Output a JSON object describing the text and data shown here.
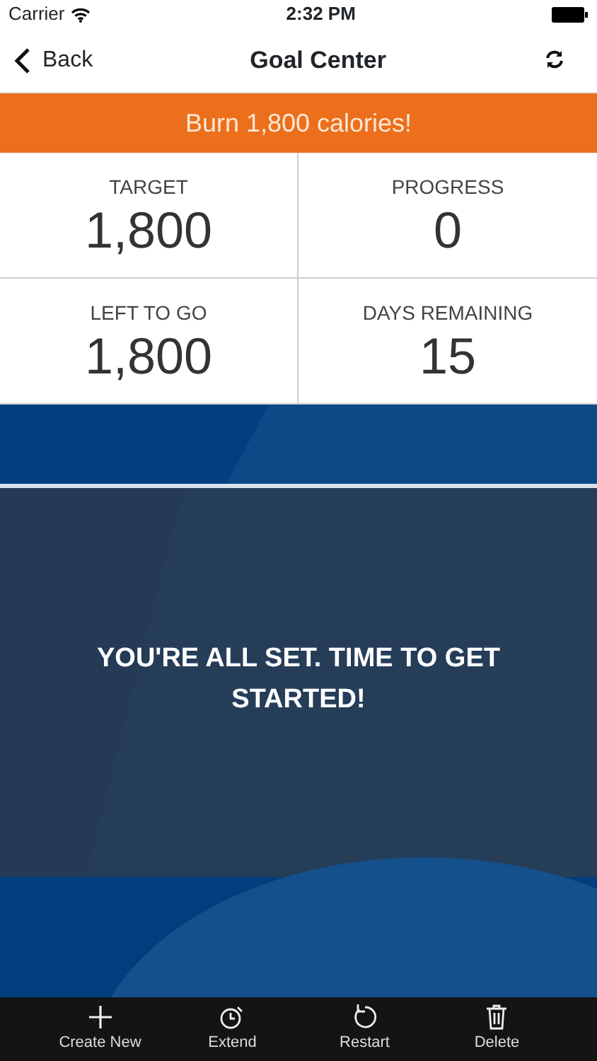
{
  "status_bar": {
    "carrier": "Carrier",
    "time": "2:32 PM"
  },
  "nav": {
    "back": "Back",
    "title": "Goal Center"
  },
  "banner": "Burn 1,800 calories!",
  "stats": [
    {
      "label": "TARGET",
      "value": "1,800"
    },
    {
      "label": "PROGRESS",
      "value": "0"
    },
    {
      "label": "LEFT TO GO",
      "value": "1,800"
    },
    {
      "label": "DAYS REMAINING",
      "value": "15"
    }
  ],
  "message": "YOU'RE ALL SET. TIME TO GET STARTED!",
  "toolbar": [
    {
      "kind": "create",
      "label": "Create New"
    },
    {
      "kind": "extend",
      "label": "Extend"
    },
    {
      "kind": "restart",
      "label": "Restart"
    },
    {
      "kind": "delete",
      "label": "Delete"
    }
  ]
}
